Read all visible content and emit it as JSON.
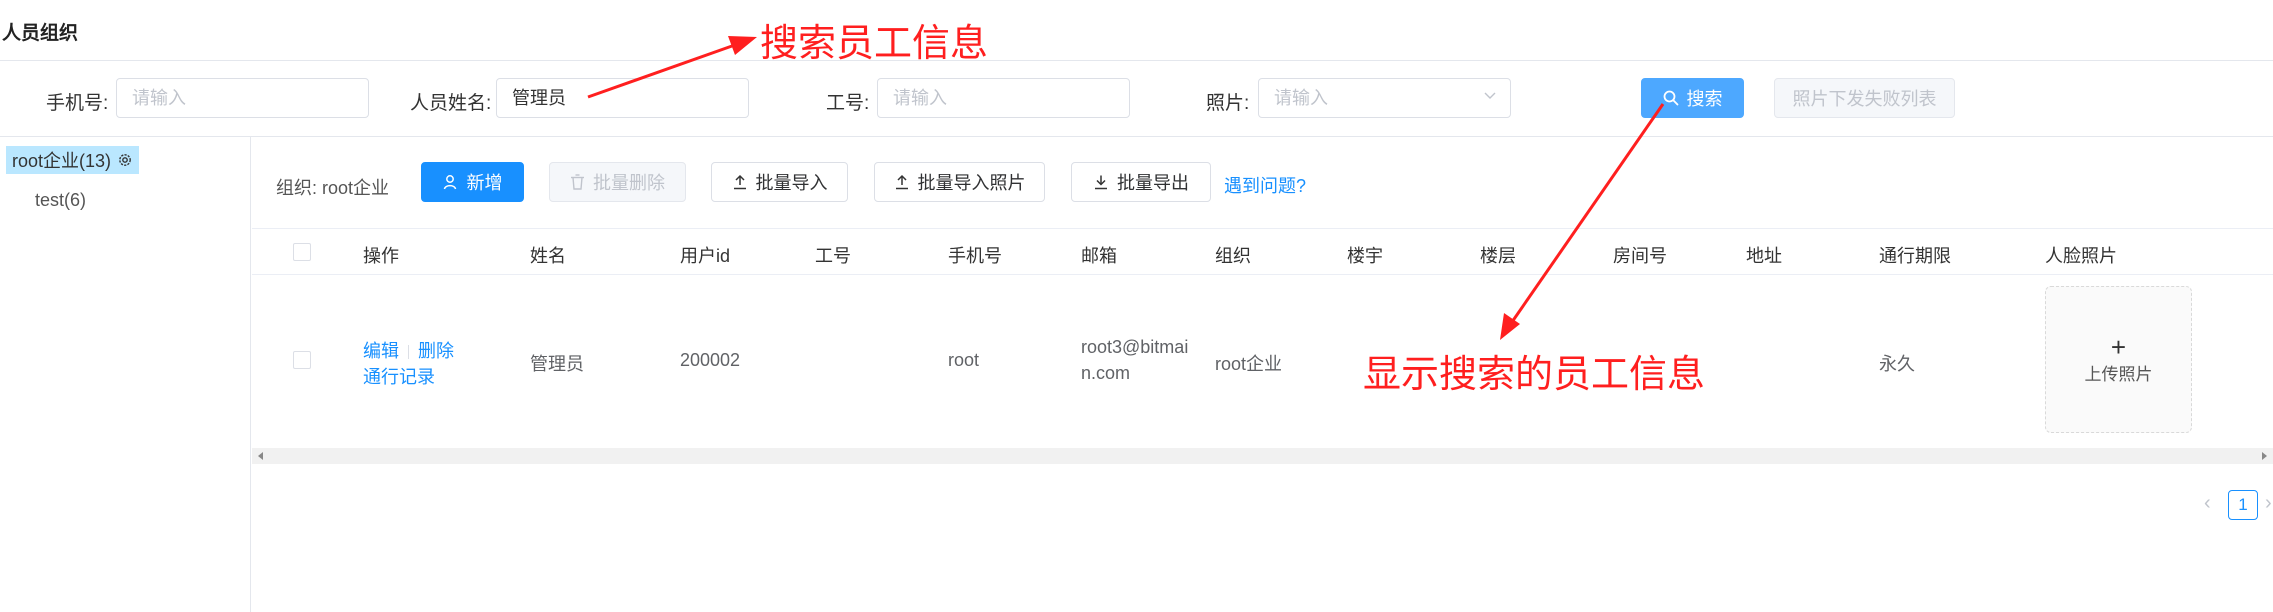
{
  "page": {
    "title": "人员组织"
  },
  "filters": {
    "phone": {
      "label": "手机号:",
      "placeholder": "请输入",
      "value": ""
    },
    "name": {
      "label": "人员姓名:",
      "placeholder": "请输入",
      "value": "管理员"
    },
    "employee_no": {
      "label": "工号:",
      "placeholder": "请输入",
      "value": ""
    },
    "photo": {
      "label": "照片:",
      "placeholder": "请输入",
      "value": ""
    },
    "search_label": "搜索",
    "failed_list_label": "照片下发失败列表"
  },
  "tree": {
    "root_label": "root企业(13)",
    "children": [
      "test(6)"
    ]
  },
  "toolbar": {
    "org_label": "组织: root企业",
    "add_label": "新增",
    "batch_delete_label": "批量删除",
    "batch_import_label": "批量导入",
    "batch_import_photos_label": "批量导入照片",
    "batch_export_label": "批量导出",
    "help_link": "遇到问题?"
  },
  "table": {
    "columns": [
      "操作",
      "姓名",
      "用户id",
      "工号",
      "手机号",
      "邮箱",
      "组织",
      "楼宇",
      "楼层",
      "房间号",
      "地址",
      "通行期限",
      "人脸照片"
    ],
    "rows": [
      {
        "actions": {
          "edit": "编辑",
          "delete": "删除",
          "records": "通行记录"
        },
        "name": "管理员",
        "user_id": "200002",
        "employee_no": "",
        "phone": "root",
        "email_line1": "root3@bitmai",
        "email_line2": "n.com",
        "org": "root企业",
        "building": "",
        "floor": "",
        "room": "",
        "address": "",
        "access_period": "永久",
        "face_photo": {
          "plus": "+",
          "upload_label": "上传照片"
        }
      }
    ]
  },
  "pagination": {
    "prev": "‹",
    "current": "1",
    "next": "›"
  },
  "annotations": {
    "search_note": "搜索员工信息",
    "result_note": "显示搜索的员工信息",
    "color": "#ff1f1f"
  },
  "colors": {
    "primary": "#1890ff",
    "search": "#4da8ff",
    "tree_selected": "#bae7ff"
  }
}
